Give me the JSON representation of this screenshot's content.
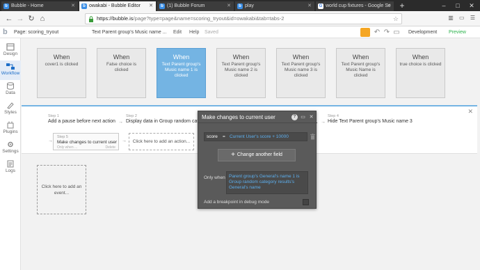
{
  "browser": {
    "tabs": [
      {
        "title": "Bubble - Home",
        "favicon": "b",
        "active": false
      },
      {
        "title": "owakabi - Bubble Editor",
        "favicon": "b",
        "active": true
      },
      {
        "title": "(1) Bubble Forum",
        "favicon": "b",
        "active": false
      },
      {
        "title": "play",
        "favicon": "b",
        "active": false
      },
      {
        "title": "world cup fixtures - Google Se",
        "favicon": "G",
        "active": false
      }
    ],
    "new_tab": "+",
    "url_host": "https://bubble.is",
    "url_path": "/page?type=page&name=scoring_tryout&id=owakabi&tab=tabs-2"
  },
  "editor": {
    "page_label": "Page: scoring_tryout",
    "element_label": "Text Parent group's Music name ...",
    "menu": {
      "edit": "Edit",
      "help": "Help",
      "saved": "Saved"
    },
    "environment": "Development",
    "preview": "Preview"
  },
  "sidebar": [
    {
      "label": "Design",
      "icon": "design-icon",
      "active": false
    },
    {
      "label": "Workflow",
      "icon": "workflow-icon",
      "active": true
    },
    {
      "label": "Data",
      "icon": "data-icon",
      "active": false
    },
    {
      "label": "Styles",
      "icon": "styles-icon",
      "active": false
    },
    {
      "label": "Plugins",
      "icon": "plugins-icon",
      "active": false
    },
    {
      "label": "Settings",
      "icon": "settings-icon",
      "active": false
    },
    {
      "label": "Logs",
      "icon": "logs-icon",
      "active": false
    }
  ],
  "events": [
    {
      "when": "When",
      "desc": "cover1 is clicked",
      "selected": false
    },
    {
      "when": "When",
      "desc": "False choice is clicked",
      "selected": false
    },
    {
      "when": "When",
      "desc": "Text Parent group's Music name 1 is clicked",
      "selected": true
    },
    {
      "when": "When",
      "desc": "Text Parent group's Music name 2 is clicked",
      "selected": false
    },
    {
      "when": "When",
      "desc": "Text Parent group's Music name 3 is clicked",
      "selected": false
    },
    {
      "when": "When",
      "desc": "Text Parent group's Music Name is clicked",
      "selected": false
    },
    {
      "when": "When",
      "desc": "true choice is clicked",
      "selected": false
    }
  ],
  "steps": {
    "step1": {
      "num": "Step 1",
      "text": "Add a pause before next action"
    },
    "step2": {
      "num": "Step 2",
      "text": "Display data in Group random categ"
    },
    "step4": {
      "num": "Step 4",
      "text": "Hide Text Parent group's Music name 3"
    },
    "step5": {
      "num": "Step 5",
      "text": "Make changes to current user",
      "only_when": "Only when ...",
      "delete": "Delete"
    },
    "add_action": "Click here to add an action...",
    "add_event": "Click here to add an event..."
  },
  "dialog": {
    "title": "Make changes to current user",
    "field": "score",
    "equals": "=",
    "value": "Current User's score + 10000",
    "change_button": "Change another field",
    "only_when_label": "Only when",
    "only_when_expr": "Parent group's General's name 1 is Group random category results's General's name",
    "breakpoint_label": "Add a breakpoint in debug mode"
  },
  "colors": {
    "selected_event": "#74b4e3",
    "preview_green": "#2bb24c",
    "dynamic_blue": "#5db0f0",
    "accent_orange": "#f5a623"
  }
}
